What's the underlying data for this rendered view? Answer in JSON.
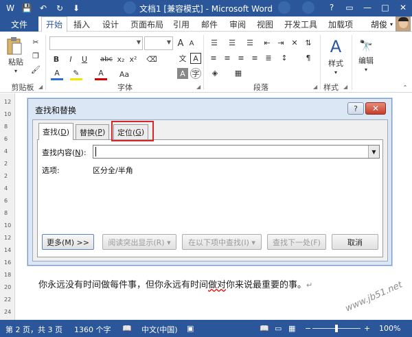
{
  "titlebar": {
    "title": "文档1 [兼容模式] - Microsoft Word",
    "qat": [
      "W",
      "💾",
      "↶",
      "↻",
      "⬇"
    ],
    "controls": [
      "?",
      "▭",
      "—",
      "□",
      "✕"
    ]
  },
  "tabs": {
    "file": "文件",
    "items": [
      "开始",
      "插入",
      "设计",
      "页面布局",
      "引用",
      "邮件",
      "审阅",
      "视图",
      "开发工具",
      "加载项"
    ],
    "user": "胡俊"
  },
  "ribbon": {
    "groups": [
      "剪贴板",
      "字体",
      "段落",
      "样式"
    ],
    "paste": "粘贴",
    "styles": "样式",
    "edit": "编辑",
    "font_buttons": [
      "B",
      "I",
      "U",
      "abc",
      "x₂",
      "x²"
    ],
    "font_size_up": "A",
    "font_size_down": "A"
  },
  "ruler_ticks": [
    "12",
    "10",
    "8",
    "6",
    "4",
    "2",
    "2",
    "4",
    "6",
    "8",
    "10",
    "12",
    "14",
    "16",
    "18",
    "20",
    "22",
    "24"
  ],
  "dialog": {
    "title": "查找和替换",
    "help": "?",
    "close": "✕",
    "tabs": [
      {
        "label": "查找(",
        "key": "D",
        "suffix": ")"
      },
      {
        "label": "替换(",
        "key": "P",
        "suffix": ")"
      },
      {
        "label": "定位(",
        "key": "G",
        "suffix": ")"
      }
    ],
    "find_label": "查找内容(",
    "find_key": "N",
    "find_suffix": "):",
    "find_value": "",
    "options_label": "选项:",
    "options_value": "区分全/半角",
    "buttons": {
      "more": "更多(M) >>",
      "reading_highlight": "阅读突出显示(R) ▾",
      "find_in": "在以下项中查找(I) ▾",
      "find_next": "查找下一处(F)",
      "cancel": "取消"
    }
  },
  "document": {
    "text_before": "你永远没有时间做每件事，但你永远有时间",
    "text_squiggle": "做对",
    "text_after": "你来说最重要的事。",
    "para_mark": "↵"
  },
  "statusbar": {
    "page": "第 2 页，共 3 页",
    "words": "1360 个字",
    "language": "中文(中国)",
    "zoom": "100%",
    "zoom_minus": "−",
    "zoom_plus": "+"
  },
  "watermark": "www.jb51.net"
}
